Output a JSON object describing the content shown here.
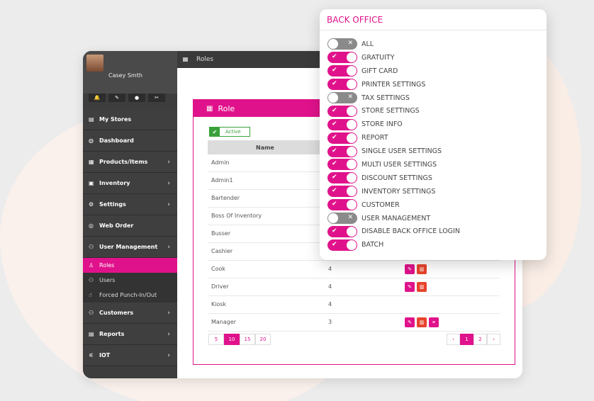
{
  "colors": {
    "accent": "#e0128b",
    "sidebar": "#3d3d3d",
    "active_green": "#3aa13a"
  },
  "user": {
    "name": "Casey Smth",
    "icons": [
      "bell-icon",
      "wrench-icon",
      "eye-icon",
      "scissors-icon"
    ]
  },
  "topbar": {
    "title": "Roles"
  },
  "sidebar": {
    "items": [
      {
        "label": "My Stores",
        "icon": "store-icon",
        "chevron": false
      },
      {
        "label": "Dashboard",
        "icon": "dashboard-icon",
        "chevron": false
      },
      {
        "label": "Products/Items",
        "icon": "products-icon",
        "chevron": true
      },
      {
        "label": "Inventory",
        "icon": "inventory-icon",
        "chevron": true
      },
      {
        "label": "Settings",
        "icon": "settings-icon",
        "chevron": true
      },
      {
        "label": "Web Order",
        "icon": "web-order-icon",
        "chevron": false
      },
      {
        "label": "User Management",
        "icon": "users-icon",
        "chevron": true
      }
    ],
    "subitems": [
      {
        "label": "Roles",
        "icon": "user-icon",
        "active": true
      },
      {
        "label": "Users",
        "icon": "users-icon",
        "active": false
      },
      {
        "label": "Forced Punch-In/Out",
        "icon": "thumb-icon",
        "active": false
      }
    ],
    "items2": [
      {
        "label": "Customers",
        "icon": "customers-icon",
        "chevron": true
      },
      {
        "label": "Reports",
        "icon": "reports-icon",
        "chevron": true
      },
      {
        "label": "IOT",
        "icon": "iot-icon",
        "chevron": true
      }
    ]
  },
  "panel": {
    "title": "Role",
    "active_label": "Active",
    "column_name": "Name",
    "rows": [
      {
        "name": "Admin",
        "count": "",
        "actions": []
      },
      {
        "name": "Admin1",
        "count": "",
        "actions": []
      },
      {
        "name": "Bartender",
        "count": "",
        "actions": []
      },
      {
        "name": "Boss Of Inventory",
        "count": "",
        "actions": []
      },
      {
        "name": "Busser",
        "count": "",
        "actions": []
      },
      {
        "name": "Cashier",
        "count": "",
        "actions": []
      },
      {
        "name": "Cook",
        "count": "4",
        "actions": [
          "edit",
          "delete"
        ]
      },
      {
        "name": "Driver",
        "count": "4",
        "actions": [
          "edit",
          "delete"
        ]
      },
      {
        "name": "Kiosk",
        "count": "4",
        "actions": []
      },
      {
        "name": "Manager",
        "count": "3",
        "actions": [
          "edit",
          "delete",
          "link"
        ]
      }
    ],
    "page_sizes": [
      "5",
      "10",
      "15",
      "20"
    ],
    "page_size_selected": "10",
    "pages": [
      "‹",
      "1",
      "2",
      "›"
    ],
    "page_selected": "1"
  },
  "back_office": {
    "title": "BACK OFFICE",
    "toggles": [
      {
        "label": "ALL",
        "on": false
      },
      {
        "label": "GRATUITY",
        "on": true
      },
      {
        "label": "GIFT CARD",
        "on": true
      },
      {
        "label": "PRINTER SETTINGS",
        "on": true
      },
      {
        "label": "TAX SETTINGS",
        "on": false
      },
      {
        "label": "STORE SETTINGS",
        "on": true
      },
      {
        "label": "STORE INFO",
        "on": true
      },
      {
        "label": "REPORT",
        "on": true
      },
      {
        "label": "SINGLE USER SETTINGS",
        "on": true
      },
      {
        "label": "MULTI USER SETTINGS",
        "on": true
      },
      {
        "label": "DISCOUNT SETTINGS",
        "on": true
      },
      {
        "label": "INVENTORY SETTINGS",
        "on": true
      },
      {
        "label": "CUSTOMER",
        "on": true
      },
      {
        "label": "USER MANAGEMENT",
        "on": false
      },
      {
        "label": "DISABLE BACK OFFICE LOGIN",
        "on": true
      },
      {
        "label": "BATCH",
        "on": true
      }
    ]
  }
}
